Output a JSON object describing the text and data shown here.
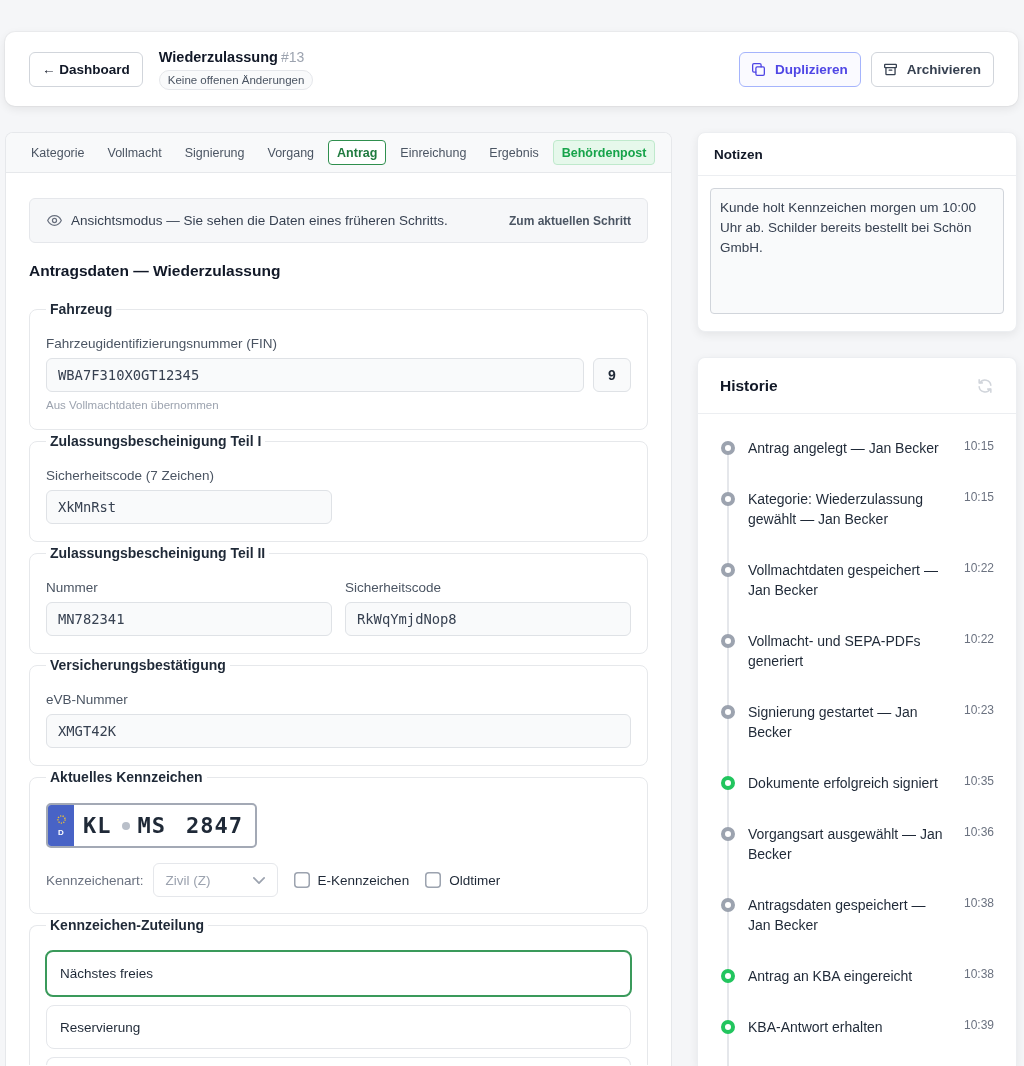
{
  "header": {
    "back_button": "← Dashboard",
    "title": "Wiederzulassung",
    "number": "#13",
    "status": "Keine offenen Änderungen",
    "actions": [
      {
        "label": "Duplizieren",
        "kind": "duplicate"
      },
      {
        "label": "Archivieren",
        "kind": "archive"
      }
    ]
  },
  "tabs": [
    {
      "label": "Kategorie",
      "selected": false,
      "highlighted": false
    },
    {
      "label": "Vollmacht",
      "selected": false,
      "highlighted": false
    },
    {
      "label": "Signierung",
      "selected": false,
      "highlighted": false
    },
    {
      "label": "Vorgang",
      "selected": false,
      "highlighted": false
    },
    {
      "label": "Antrag",
      "selected": true,
      "highlighted": false
    },
    {
      "label": "Einreichung",
      "selected": false,
      "highlighted": false
    },
    {
      "label": "Ergebnis",
      "selected": false,
      "highlighted": false
    },
    {
      "label": "Behördenpost",
      "selected": false,
      "highlighted": true
    }
  ],
  "notice": {
    "text": "Ansichtsmodus — Sie sehen die Daten eines früheren Schritts.",
    "link": "Zum aktuellen Schritt"
  },
  "form_title": "Antragsdaten — Wiederzulassung",
  "sections": [
    {
      "kind": "fields",
      "legend": "Fahrzeug",
      "fields": [
        {
          "kind": "fin",
          "label": "Fahrzeugidentifizierungsnummer (FIN)",
          "value": "WBA7F310X0GT12345",
          "check_digit": "9",
          "hint": "Aus Vollmachtdaten übernommen"
        }
      ]
    },
    {
      "kind": "fields",
      "legend": "Zulassungsbescheinigung Teil I",
      "fields": [
        {
          "kind": "short",
          "label": "Sicherheitscode (7 Zeichen)",
          "value": "XkMnRst"
        }
      ]
    },
    {
      "kind": "fields",
      "legend": "Zulassungsbescheinigung Teil II",
      "fields": [
        {
          "kind": "short",
          "label": "Nummer",
          "value": "MN782341"
        },
        {
          "kind": "short",
          "label": "Sicherheitscode",
          "value": "RkWqYmjdNop8"
        }
      ]
    },
    {
      "kind": "fields",
      "legend": "Versicherungsbestätigung",
      "fields": [
        {
          "kind": "text",
          "label": "eVB-Nummer",
          "value": "XMGT42K"
        }
      ]
    },
    {
      "kind": "plate",
      "legend": "Aktuelles Kennzeichen",
      "plate": {
        "country": "D",
        "district": "KL",
        "letters": "MS",
        "digits": "2847"
      },
      "plate_type": {
        "label": "Kennzeichenart:",
        "value": "Zivil (Z)",
        "disabled": true
      },
      "checkboxes": [
        {
          "label": "E-Kennzeichen",
          "checked": false
        },
        {
          "label": "Oldtimer",
          "checked": false
        }
      ]
    },
    {
      "kind": "options",
      "legend": "Kennzeichen-Zuteilung",
      "options": [
        {
          "label": "Nächstes freies",
          "selected": true
        },
        {
          "label": "Reservierung",
          "selected": false
        },
        {
          "selected": false
        }
      ]
    }
  ],
  "notes": {
    "title": "Notizen",
    "value": "Kunde holt Kennzeichen morgen um 10:00 Uhr ab. Schilder bereits bestellt bei Schön GmbH."
  },
  "history": {
    "title": "Historie",
    "entries": [
      {
        "text": "Antrag angelegt — Jan Becker",
        "time": "10:15",
        "color": "#9ca3af"
      },
      {
        "text": "Kategorie: Wiederzulassung gewählt — Jan Becker",
        "time": "10:15",
        "color": "#9ca3af"
      },
      {
        "text": "Vollmachtdaten gespeichert — Jan Becker",
        "time": "10:22",
        "color": "#9ca3af"
      },
      {
        "text": "Vollmacht- und SEPA-PDFs generiert",
        "time": "10:22",
        "color": "#9ca3af"
      },
      {
        "text": "Signierung gestartet — Jan Becker",
        "time": "10:23",
        "color": "#9ca3af"
      },
      {
        "text": "Dokumente erfolgreich signiert",
        "time": "10:35",
        "color": "#22c55e"
      },
      {
        "text": "Vorgangsart ausgewählt — Jan Becker",
        "time": "10:36",
        "color": "#9ca3af"
      },
      {
        "text": "Antragsdaten gespeichert — Jan Becker",
        "time": "10:38",
        "color": "#9ca3af"
      },
      {
        "text": "Antrag an KBA eingereicht",
        "time": "10:38",
        "color": "#22c55e"
      },
      {
        "text": "KBA-Antwort erhalten",
        "time": "10:39",
        "color": "#22c55e"
      }
    ]
  }
}
